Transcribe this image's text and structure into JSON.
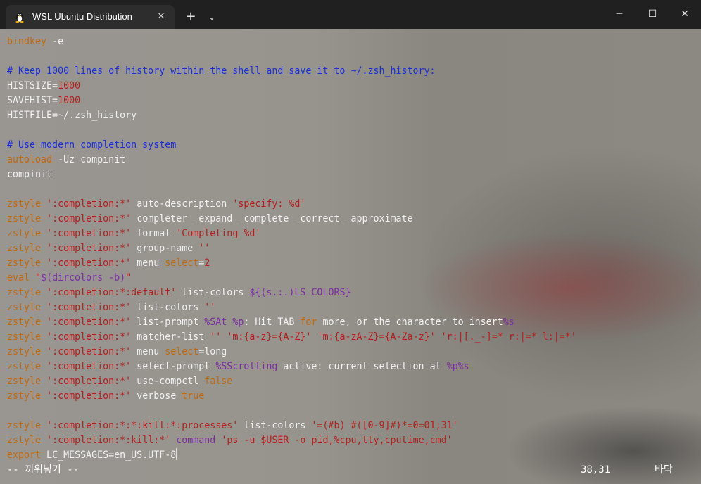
{
  "window": {
    "tab_title": "WSL Ubuntu Distribution",
    "tab_icon": "linux-penguin-icon",
    "close_tab_glyph": "✕",
    "new_tab_glyph": "+",
    "dropdown_glyph": "⌄",
    "minimize_glyph": "─",
    "maximize_glyph": "☐",
    "close_glyph": "✕"
  },
  "colors": {
    "comment": "#1b2fd6",
    "keyword": "#c1690f",
    "string": "#b81e1e",
    "special": "#7d2da8",
    "text": "#f0f0f0"
  },
  "editor": {
    "lines": [
      [
        {
          "t": "bindkey",
          "c": "kw"
        },
        {
          "t": " -e",
          "c": ""
        }
      ],
      [],
      [
        {
          "t": "# Keep 1000 lines of history within the shell and save it to ~/.zsh_history:",
          "c": "cmt"
        }
      ],
      [
        {
          "t": "HISTSIZE=",
          "c": ""
        },
        {
          "t": "1000",
          "c": "num"
        }
      ],
      [
        {
          "t": "SAVEHIST=",
          "c": ""
        },
        {
          "t": "1000",
          "c": "num"
        }
      ],
      [
        {
          "t": "HISTFILE=~/.zsh_history",
          "c": ""
        }
      ],
      [],
      [
        {
          "t": "# Use modern completion system",
          "c": "cmt"
        }
      ],
      [
        {
          "t": "autoload",
          "c": "kw"
        },
        {
          "t": " -Uz compinit",
          "c": ""
        }
      ],
      [
        {
          "t": "compinit",
          "c": ""
        }
      ],
      [],
      [
        {
          "t": "zstyle",
          "c": "kw"
        },
        {
          "t": " ",
          "c": ""
        },
        {
          "t": "':completion:*'",
          "c": "str"
        },
        {
          "t": " auto-description ",
          "c": ""
        },
        {
          "t": "'specify: %d'",
          "c": "str"
        }
      ],
      [
        {
          "t": "zstyle",
          "c": "kw"
        },
        {
          "t": " ",
          "c": ""
        },
        {
          "t": "':completion:*'",
          "c": "str"
        },
        {
          "t": " completer _expand _complete _correct _approximate",
          "c": ""
        }
      ],
      [
        {
          "t": "zstyle",
          "c": "kw"
        },
        {
          "t": " ",
          "c": ""
        },
        {
          "t": "':completion:*'",
          "c": "str"
        },
        {
          "t": " format ",
          "c": ""
        },
        {
          "t": "'Completing %d'",
          "c": "str"
        }
      ],
      [
        {
          "t": "zstyle",
          "c": "kw"
        },
        {
          "t": " ",
          "c": ""
        },
        {
          "t": "':completion:*'",
          "c": "str"
        },
        {
          "t": " group-name ",
          "c": ""
        },
        {
          "t": "''",
          "c": "str"
        }
      ],
      [
        {
          "t": "zstyle",
          "c": "kw"
        },
        {
          "t": " ",
          "c": ""
        },
        {
          "t": "':completion:*'",
          "c": "str"
        },
        {
          "t": " menu ",
          "c": ""
        },
        {
          "t": "select",
          "c": "kw"
        },
        {
          "t": "=",
          "c": ""
        },
        {
          "t": "2",
          "c": "num"
        }
      ],
      [
        {
          "t": "eval",
          "c": "kw"
        },
        {
          "t": " ",
          "c": ""
        },
        {
          "t": "\"",
          "c": "str"
        },
        {
          "t": "$(dircolors -b)",
          "c": "sym"
        },
        {
          "t": "\"",
          "c": "str"
        }
      ],
      [
        {
          "t": "zstyle",
          "c": "kw"
        },
        {
          "t": " ",
          "c": ""
        },
        {
          "t": "':completion:*:default'",
          "c": "str"
        },
        {
          "t": " list-colors ",
          "c": ""
        },
        {
          "t": "${(s.:.)LS_COLORS}",
          "c": "sym"
        }
      ],
      [
        {
          "t": "zstyle",
          "c": "kw"
        },
        {
          "t": " ",
          "c": ""
        },
        {
          "t": "':completion:*'",
          "c": "str"
        },
        {
          "t": " list-colors ",
          "c": ""
        },
        {
          "t": "''",
          "c": "str"
        }
      ],
      [
        {
          "t": "zstyle",
          "c": "kw"
        },
        {
          "t": " ",
          "c": ""
        },
        {
          "t": "':completion:*'",
          "c": "str"
        },
        {
          "t": " list-prompt ",
          "c": ""
        },
        {
          "t": "%SAt %p",
          "c": "sym"
        },
        {
          "t": ": Hit TAB ",
          "c": ""
        },
        {
          "t": "for",
          "c": "kw"
        },
        {
          "t": " more, or the character to insert",
          "c": ""
        },
        {
          "t": "%s",
          "c": "sym"
        }
      ],
      [
        {
          "t": "zstyle",
          "c": "kw"
        },
        {
          "t": " ",
          "c": ""
        },
        {
          "t": "':completion:*'",
          "c": "str"
        },
        {
          "t": " matcher-list ",
          "c": ""
        },
        {
          "t": "''",
          "c": "str"
        },
        {
          "t": " ",
          "c": ""
        },
        {
          "t": "'m:{a-z}={A-Z}'",
          "c": "str"
        },
        {
          "t": " ",
          "c": ""
        },
        {
          "t": "'m:{a-zA-Z}={A-Za-z}'",
          "c": "str"
        },
        {
          "t": " ",
          "c": ""
        },
        {
          "t": "'r:|[._-]=* r:|=* l:|=*'",
          "c": "str"
        }
      ],
      [
        {
          "t": "zstyle",
          "c": "kw"
        },
        {
          "t": " ",
          "c": ""
        },
        {
          "t": "':completion:*'",
          "c": "str"
        },
        {
          "t": " menu ",
          "c": ""
        },
        {
          "t": "select",
          "c": "kw"
        },
        {
          "t": "=long",
          "c": ""
        }
      ],
      [
        {
          "t": "zstyle",
          "c": "kw"
        },
        {
          "t": " ",
          "c": ""
        },
        {
          "t": "':completion:*'",
          "c": "str"
        },
        {
          "t": " select-prompt ",
          "c": ""
        },
        {
          "t": "%SScrolling",
          "c": "sym"
        },
        {
          "t": " active: current selection at ",
          "c": ""
        },
        {
          "t": "%p%s",
          "c": "sym"
        }
      ],
      [
        {
          "t": "zstyle",
          "c": "kw"
        },
        {
          "t": " ",
          "c": ""
        },
        {
          "t": "':completion:*'",
          "c": "str"
        },
        {
          "t": " use-compctl ",
          "c": ""
        },
        {
          "t": "false",
          "c": "kw"
        }
      ],
      [
        {
          "t": "zstyle",
          "c": "kw"
        },
        {
          "t": " ",
          "c": ""
        },
        {
          "t": "':completion:*'",
          "c": "str"
        },
        {
          "t": " verbose ",
          "c": ""
        },
        {
          "t": "true",
          "c": "kw"
        }
      ],
      [],
      [
        {
          "t": "zstyle",
          "c": "kw"
        },
        {
          "t": " ",
          "c": ""
        },
        {
          "t": "':completion:*:*:kill:*:processes'",
          "c": "str"
        },
        {
          "t": " list-colors ",
          "c": ""
        },
        {
          "t": "'=(#b) #([0-9]#)*=0=01;31'",
          "c": "str"
        }
      ],
      [
        {
          "t": "zstyle",
          "c": "kw"
        },
        {
          "t": " ",
          "c": ""
        },
        {
          "t": "':completion:*:kill:*'",
          "c": "str"
        },
        {
          "t": " ",
          "c": ""
        },
        {
          "t": "command",
          "c": "sym"
        },
        {
          "t": " ",
          "c": ""
        },
        {
          "t": "'ps -u $USER -o pid,%cpu,tty,cputime,cmd'",
          "c": "str"
        }
      ],
      [
        {
          "t": "export",
          "c": "kw"
        },
        {
          "t": " LC_MESSAGES=en_US.UTF-8",
          "c": ""
        }
      ]
    ]
  },
  "status": {
    "mode": "-- 끼워넣기 --",
    "cursor_pos": "38,31",
    "scroll_pos": "바닥"
  }
}
